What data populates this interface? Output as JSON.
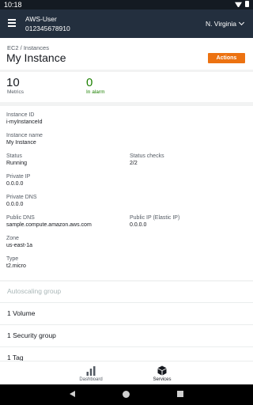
{
  "status_bar": {
    "time": "10:18"
  },
  "appbar": {
    "account_name": "AWS-User",
    "account_id": "012345678910",
    "region": "N. Virginia"
  },
  "header": {
    "breadcrumb": "EC2 / Instances",
    "title": "My Instance",
    "actions_label": "Actions"
  },
  "metrics": [
    {
      "value": "10",
      "label": "Metrics"
    },
    {
      "value": "0",
      "label": "In alarm"
    }
  ],
  "details": {
    "instance_id": {
      "label": "Instance ID",
      "value": "i-myInstanceId"
    },
    "instance_name": {
      "label": "Instance name",
      "value": "My Instance"
    },
    "status": {
      "label": "Status",
      "value": "Running"
    },
    "status_checks": {
      "label": "Status checks",
      "value": "2/2"
    },
    "private_ip": {
      "label": "Private IP",
      "value": "0.0.0.0"
    },
    "private_dns": {
      "label": "Private DNS",
      "value": "0.0.0.0"
    },
    "public_dns": {
      "label": "Public DNS",
      "value": "sample.compute.amazon.aws.com"
    },
    "public_ip": {
      "label": "Public IP (Elastic IP)",
      "value": "0.0.0.0"
    },
    "zone": {
      "label": "Zone",
      "value": "us-east-1a"
    },
    "type": {
      "label": "Type",
      "value": "t2.micro"
    }
  },
  "autoscaling_header": "Autoscaling group",
  "resources": [
    {
      "label": "1 Volume"
    },
    {
      "label": "1 Security group"
    },
    {
      "label": "1 Tag"
    }
  ],
  "bottom_nav": [
    {
      "label": "Dashboard",
      "icon": "bar-chart-icon"
    },
    {
      "label": "Services",
      "icon": "cube-icon"
    }
  ],
  "colors": {
    "appbar": "#232f3e",
    "accent": "#ec7211",
    "success": "#1d8102"
  }
}
